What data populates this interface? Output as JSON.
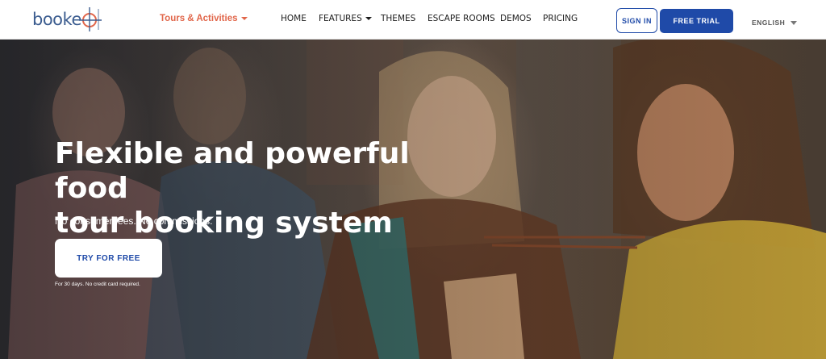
{
  "header": {
    "logo_text": "booke",
    "tours_menu": "Tours & Activities",
    "nav": [
      {
        "label": "HOME"
      },
      {
        "label": "FEATURES"
      },
      {
        "label": "THEMES"
      },
      {
        "label": "ESCAPE ROOMS"
      },
      {
        "label": "DEMOS"
      },
      {
        "label": "PRICING"
      }
    ],
    "sign_in": "SIGN IN",
    "free_trial": "FREE TRIAL",
    "language": "ENGLISH"
  },
  "hero": {
    "title_line1": "Flexible and powerful food",
    "title_line2": "tour booking system",
    "subtitle": "No consumer fees. No commissions.",
    "cta": "TRY FOR FREE",
    "note": "For 30 days. No credit card required."
  },
  "colors": {
    "brand_blue": "#1f4aa8",
    "logo_blue": "#3b5c8f",
    "accent_orange": "#e1664a"
  },
  "icons": {
    "logo_mark": "crosshair-target-icon",
    "dropdown": "caret-down-icon"
  }
}
